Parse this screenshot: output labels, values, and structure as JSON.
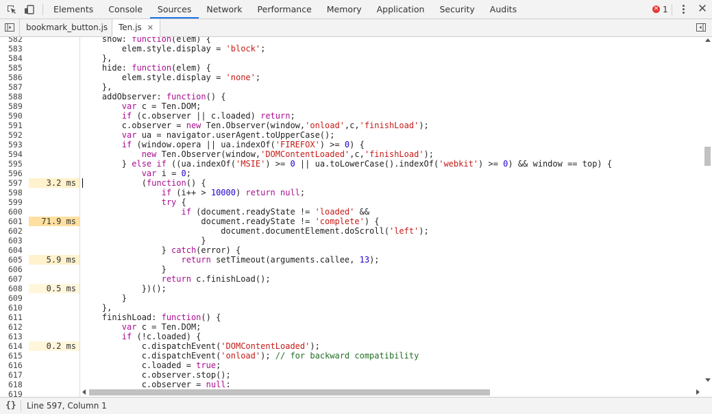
{
  "toolbar": {
    "tabs": [
      "Elements",
      "Console",
      "Sources",
      "Network",
      "Performance",
      "Memory",
      "Application",
      "Security",
      "Audits"
    ],
    "active_tab": "Sources",
    "error_count": "1"
  },
  "files": {
    "tabs": [
      {
        "label": "bookmark_button.js",
        "active": false
      },
      {
        "label": "Ten.js",
        "active": true
      }
    ]
  },
  "status": {
    "braces": "{}",
    "position": "Line 597, Column 1"
  },
  "editor": {
    "lines": [
      {
        "n": "582",
        "t": "",
        "c": [
          [
            "    show: ",
            ""
          ],
          [
            "function",
            "kw"
          ],
          [
            "(elem) {",
            ""
          ]
        ]
      },
      {
        "n": "583",
        "t": "",
        "c": [
          [
            "        elem.style.display = ",
            ""
          ],
          [
            "'block'",
            "str"
          ],
          [
            ";",
            ""
          ]
        ]
      },
      {
        "n": "584",
        "t": "",
        "c": [
          [
            "    },",
            ""
          ]
        ]
      },
      {
        "n": "585",
        "t": "",
        "c": [
          [
            "    hide: ",
            ""
          ],
          [
            "function",
            "kw"
          ],
          [
            "(elem) {",
            ""
          ]
        ]
      },
      {
        "n": "586",
        "t": "",
        "c": [
          [
            "        elem.style.display = ",
            ""
          ],
          [
            "'none'",
            "str"
          ],
          [
            ";",
            ""
          ]
        ]
      },
      {
        "n": "587",
        "t": "",
        "c": [
          [
            "    },",
            ""
          ]
        ]
      },
      {
        "n": "588",
        "t": "",
        "c": [
          [
            "    addObserver: ",
            ""
          ],
          [
            "function",
            "kw"
          ],
          [
            "() {",
            ""
          ]
        ]
      },
      {
        "n": "589",
        "t": "",
        "c": [
          [
            "        ",
            ""
          ],
          [
            "var",
            "kw"
          ],
          [
            " c = Ten.DOM;",
            ""
          ]
        ]
      },
      {
        "n": "590",
        "t": "",
        "c": [
          [
            "        ",
            ""
          ],
          [
            "if",
            "kw"
          ],
          [
            " (c.observer || c.loaded) ",
            ""
          ],
          [
            "return",
            "kw"
          ],
          [
            ";",
            ""
          ]
        ]
      },
      {
        "n": "591",
        "t": "",
        "c": [
          [
            "        c.observer = ",
            ""
          ],
          [
            "new",
            "kw"
          ],
          [
            " Ten.Observer(window,",
            ""
          ],
          [
            "'onload'",
            "str"
          ],
          [
            ",c,",
            ""
          ],
          [
            "'finishLoad'",
            "str"
          ],
          [
            ");",
            ""
          ]
        ]
      },
      {
        "n": "592",
        "t": "",
        "c": [
          [
            "        ",
            ""
          ],
          [
            "var",
            "kw"
          ],
          [
            " ua = navigator.userAgent.toUpperCase();",
            ""
          ]
        ]
      },
      {
        "n": "593",
        "t": "",
        "c": [
          [
            "        ",
            ""
          ],
          [
            "if",
            "kw"
          ],
          [
            " (window.opera || ua.indexOf(",
            ""
          ],
          [
            "'FIREFOX'",
            "str"
          ],
          [
            ") >= ",
            ""
          ],
          [
            "0",
            "num"
          ],
          [
            ") {",
            ""
          ]
        ]
      },
      {
        "n": "594",
        "t": "",
        "c": [
          [
            "            ",
            ""
          ],
          [
            "new",
            "kw"
          ],
          [
            " Ten.Observer(window,",
            ""
          ],
          [
            "'DOMContentLoaded'",
            "str"
          ],
          [
            ",c,",
            ""
          ],
          [
            "'finishLoad'",
            "str"
          ],
          [
            ");",
            ""
          ]
        ]
      },
      {
        "n": "595",
        "t": "",
        "c": [
          [
            "        } ",
            ""
          ],
          [
            "else if",
            "kw"
          ],
          [
            " ((ua.indexOf(",
            ""
          ],
          [
            "'MSIE'",
            "str"
          ],
          [
            ") >= ",
            ""
          ],
          [
            "0",
            "num"
          ],
          [
            " || ua.toLowerCase().indexOf(",
            ""
          ],
          [
            "'webkit'",
            "str"
          ],
          [
            ") >= ",
            ""
          ],
          [
            "0",
            "num"
          ],
          [
            ") && window == top) {",
            ""
          ]
        ]
      },
      {
        "n": "596",
        "t": "",
        "c": [
          [
            "            ",
            ""
          ],
          [
            "var",
            "kw"
          ],
          [
            " i = ",
            ""
          ],
          [
            "0",
            "num"
          ],
          [
            ";",
            ""
          ]
        ]
      },
      {
        "n": "597",
        "t": "3.2 ms",
        "lvl": "t1",
        "c": [
          [
            "            (",
            ""
          ],
          [
            "function",
            "kw"
          ],
          [
            "() {",
            ""
          ]
        ]
      },
      {
        "n": "598",
        "t": "",
        "c": [
          [
            "                ",
            ""
          ],
          [
            "if",
            "kw"
          ],
          [
            " (i++ > ",
            ""
          ],
          [
            "10000",
            "num"
          ],
          [
            ") ",
            ""
          ],
          [
            "return null",
            "kw"
          ],
          [
            ";",
            ""
          ]
        ]
      },
      {
        "n": "599",
        "t": "",
        "c": [
          [
            "                ",
            ""
          ],
          [
            "try",
            "kw"
          ],
          [
            " {",
            ""
          ]
        ]
      },
      {
        "n": "600",
        "t": "",
        "c": [
          [
            "                    ",
            ""
          ],
          [
            "if",
            "kw"
          ],
          [
            " (document.readyState != ",
            ""
          ],
          [
            "'loaded'",
            "str"
          ],
          [
            " &&",
            ""
          ]
        ]
      },
      {
        "n": "601",
        "t": "71.9 ms",
        "lvl": "t2",
        "c": [
          [
            "                        document.readyState != ",
            ""
          ],
          [
            "'complete'",
            "str"
          ],
          [
            ") {",
            ""
          ]
        ]
      },
      {
        "n": "602",
        "t": "",
        "c": [
          [
            "                            document.documentElement.doScroll(",
            ""
          ],
          [
            "'left'",
            "str"
          ],
          [
            ");",
            ""
          ]
        ]
      },
      {
        "n": "603",
        "t": "",
        "c": [
          [
            "                        }",
            ""
          ]
        ]
      },
      {
        "n": "604",
        "t": "",
        "c": [
          [
            "                } ",
            ""
          ],
          [
            "catch",
            "kw"
          ],
          [
            "(error) {",
            ""
          ]
        ]
      },
      {
        "n": "605",
        "t": "5.9 ms",
        "lvl": "t1",
        "c": [
          [
            "                    ",
            ""
          ],
          [
            "return",
            "kw"
          ],
          [
            " setTimeout(arguments.callee, ",
            ""
          ],
          [
            "13",
            "num"
          ],
          [
            ");",
            ""
          ]
        ]
      },
      {
        "n": "606",
        "t": "",
        "c": [
          [
            "                }",
            ""
          ]
        ]
      },
      {
        "n": "607",
        "t": "",
        "c": [
          [
            "                ",
            ""
          ],
          [
            "return",
            "kw"
          ],
          [
            " c.finishLoad();",
            ""
          ]
        ]
      },
      {
        "n": "608",
        "t": "0.5 ms",
        "lvl": "t0",
        "c": [
          [
            "            })();",
            ""
          ]
        ]
      },
      {
        "n": "609",
        "t": "",
        "c": [
          [
            "        }",
            ""
          ]
        ]
      },
      {
        "n": "610",
        "t": "",
        "c": [
          [
            "    },",
            ""
          ]
        ]
      },
      {
        "n": "611",
        "t": "",
        "c": [
          [
            "    finishLoad: ",
            ""
          ],
          [
            "function",
            "kw"
          ],
          [
            "() {",
            ""
          ]
        ]
      },
      {
        "n": "612",
        "t": "",
        "c": [
          [
            "        ",
            ""
          ],
          [
            "var",
            "kw"
          ],
          [
            " c = Ten.DOM;",
            ""
          ]
        ]
      },
      {
        "n": "613",
        "t": "",
        "c": [
          [
            "        ",
            ""
          ],
          [
            "if",
            "kw"
          ],
          [
            " (!c.loaded) {",
            ""
          ]
        ]
      },
      {
        "n": "614",
        "t": "0.2 ms",
        "lvl": "t0",
        "c": [
          [
            "            c.dispatchEvent(",
            ""
          ],
          [
            "'DOMContentLoaded'",
            "str"
          ],
          [
            ");",
            ""
          ]
        ]
      },
      {
        "n": "615",
        "t": "",
        "c": [
          [
            "            c.dispatchEvent(",
            ""
          ],
          [
            "'onload'",
            "str"
          ],
          [
            "); ",
            ""
          ],
          [
            "// for backward compatibility",
            "cm"
          ]
        ]
      },
      {
        "n": "616",
        "t": "",
        "c": [
          [
            "            c.loaded = ",
            ""
          ],
          [
            "true",
            "kw"
          ],
          [
            ";",
            ""
          ]
        ]
      },
      {
        "n": "617",
        "t": "",
        "c": [
          [
            "            c.observer.stop();",
            ""
          ]
        ]
      },
      {
        "n": "618",
        "t": "",
        "c": [
          [
            "            c.observer = ",
            ""
          ],
          [
            "null",
            "kw"
          ],
          [
            ";",
            ""
          ]
        ]
      },
      {
        "n": "619",
        "t": "",
        "c": []
      }
    ]
  }
}
